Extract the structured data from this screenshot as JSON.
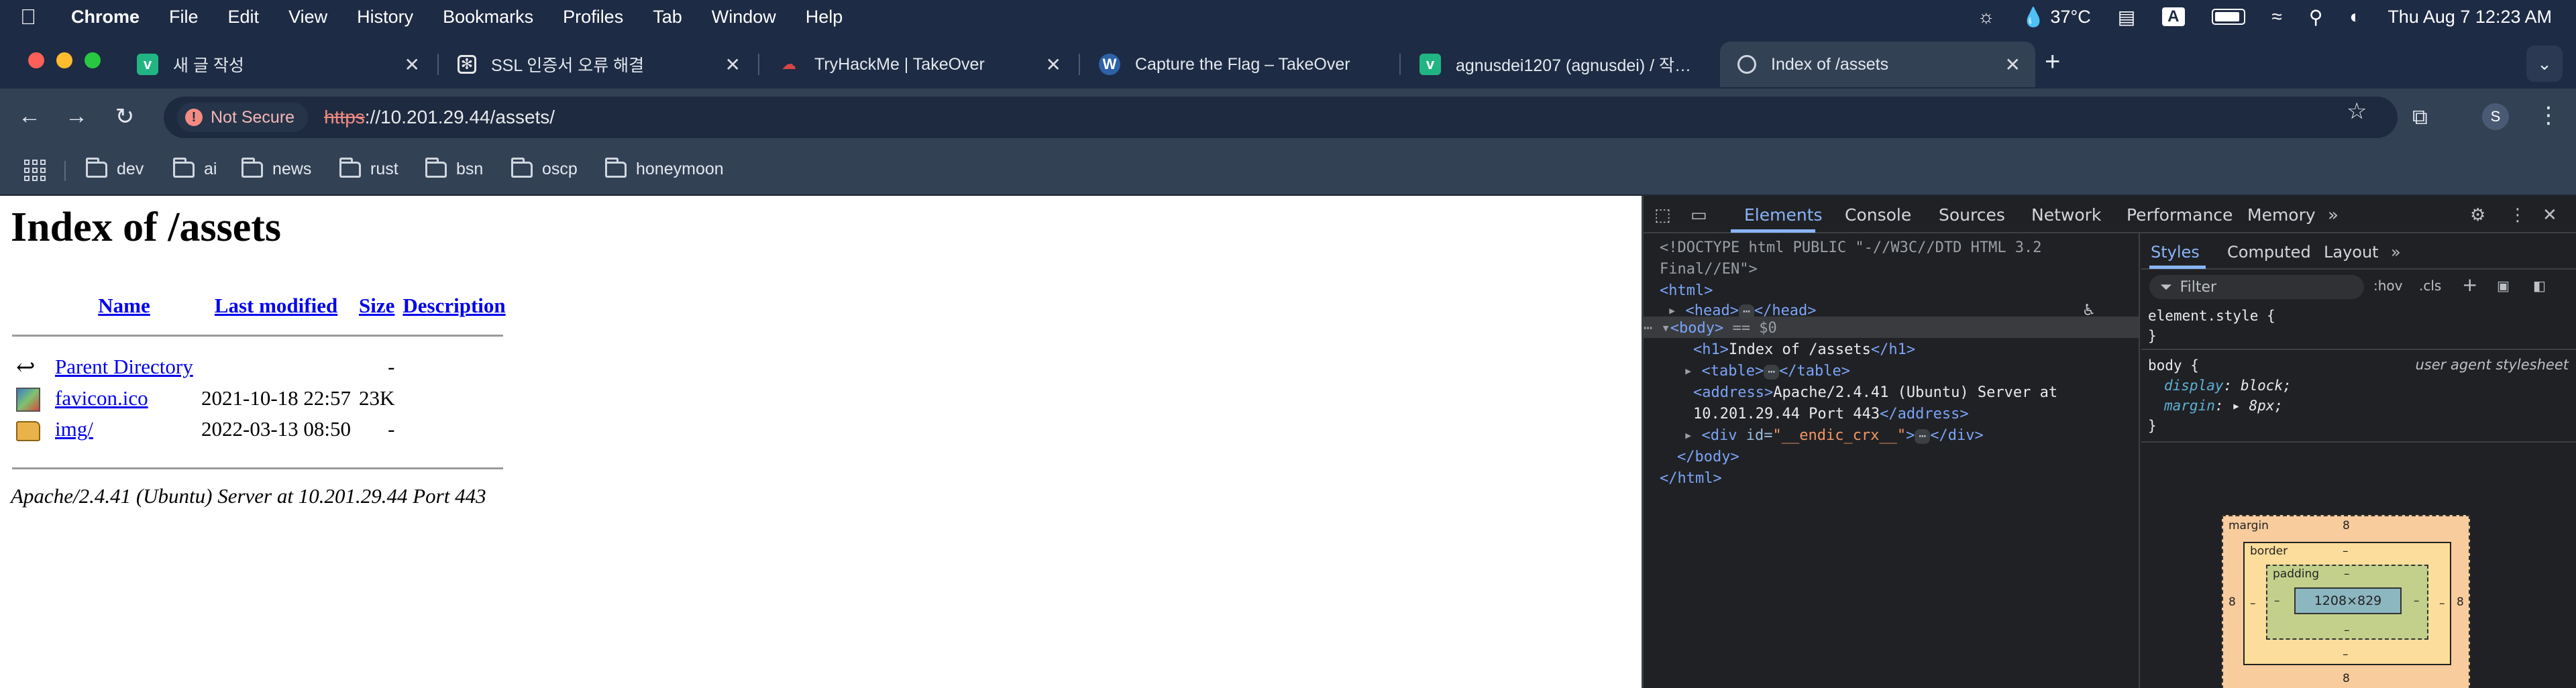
{
  "menubar": {
    "app_name": "Chrome",
    "menus": [
      "File",
      "Edit",
      "View",
      "History",
      "Bookmarks",
      "Profiles",
      "Tab",
      "Window",
      "Help"
    ],
    "temperature": "37°C",
    "input_source": "A",
    "datetime": "Thu Aug 7  12:23 AM"
  },
  "tabs": [
    {
      "title": "새 글 작성",
      "icon": "velog-icon",
      "active": false
    },
    {
      "title": "SSL 인증서 오류 해결",
      "icon": "openai-icon",
      "active": false
    },
    {
      "title": "TryHackMe | TakeOver",
      "icon": "tryhackme-icon",
      "active": false
    },
    {
      "title": "Capture the Flag – TakeOver",
      "icon": "wordpress-icon",
      "active": false
    },
    {
      "title": "agnusdei1207 (agnusdei) / 작…",
      "icon": "velog-icon",
      "active": false
    },
    {
      "title": "Index of /assets",
      "icon": "globe-icon",
      "active": true
    }
  ],
  "toolbar": {
    "security_label": "Not Secure",
    "url_scheme": "https",
    "url_rest": "://10.201.29.44/assets/",
    "profile_initial": "S"
  },
  "bookmarks": [
    "dev",
    "ai",
    "news",
    "rust",
    "bsn",
    "oscp",
    "honeymoon"
  ],
  "page": {
    "heading": "Index of /assets",
    "columns": {
      "name": "Name",
      "last_modified": "Last modified",
      "size": "Size",
      "description": "Description"
    },
    "rows": [
      {
        "name": "Parent Directory",
        "modified": "",
        "size": "-",
        "icon": "back-icon"
      },
      {
        "name": "favicon.ico",
        "modified": "2021-10-18 22:57",
        "size": "23K",
        "icon": "image-file-icon"
      },
      {
        "name": "img/",
        "modified": "2022-03-13 08:50",
        "size": "-",
        "icon": "folder-icon"
      }
    ],
    "address": "Apache/2.4.41 (Ubuntu) Server at 10.201.29.44 Port 443"
  },
  "devtools": {
    "tabs": [
      "Elements",
      "Console",
      "Sources",
      "Network",
      "Performance",
      "Memory"
    ],
    "active_tab": "Elements",
    "dom": {
      "doctype_1": "<!DOCTYPE html PUBLIC \"-//W3C//DTD HTML 3.2",
      "doctype_2": "Final//EN\">",
      "html_open": "<html>",
      "head": "<head>",
      "head_close": "</head>",
      "body": "<body>",
      "body_marker": "== $0",
      "h1_open": "<h1>",
      "h1_text": "Index of /assets",
      "h1_close": "</h1>",
      "table_open": "<table>",
      "table_close": "</table>",
      "address_open": "<address>",
      "address_text_1": "Apache/2.4.41 (Ubuntu) Server at",
      "address_text_2": "10.201.29.44 Port 443",
      "address_close": "</address>",
      "div_open": "<div ",
      "div_attr": "id",
      "div_val": "\"__endic_crx__\"",
      "div_close": "</div>",
      "body_close": "</body>",
      "html_close": "</html>"
    },
    "styles": {
      "tabs": [
        "Styles",
        "Computed",
        "Layout"
      ],
      "filter_placeholder": "Filter",
      "hov": ":hov",
      "cls": ".cls",
      "element_style": "element.style {",
      "close_brace": "}",
      "body_selector": "body {",
      "ua_label": "user agent stylesheet",
      "display_prop": "display",
      "display_val": "block;",
      "margin_prop": "margin",
      "margin_val": "8px;"
    },
    "box_model": {
      "margin_label": "margin",
      "margin_value": "8",
      "border_label": "border",
      "border_value": "–",
      "padding_label": "padding",
      "padding_value": "–",
      "content_size": "1208×829"
    }
  },
  "colors": {
    "chrome_frame": "#1d2b44",
    "toolbar": "#334155",
    "link": "#0000ee",
    "devtools_bg": "#202124",
    "devtools_accent": "#8ab4f8"
  }
}
